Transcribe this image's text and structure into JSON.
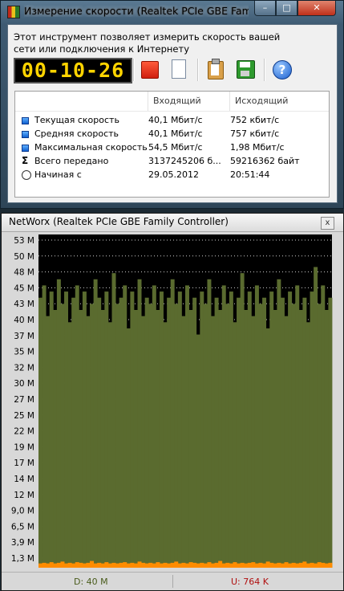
{
  "window1": {
    "title": "Измерение скорости (Realtek PCIe GBE Family Co...",
    "min_glyph": "–",
    "max_glyph": "□",
    "close_glyph": "✕",
    "description": "Этот инструмент позволяет измерить скорость вашей сети или подключения к Интернету",
    "timer": "00-10-26",
    "help_glyph": "?",
    "table": {
      "headers": [
        "",
        "Входящий",
        "Исходящий"
      ],
      "rows": [
        {
          "icon": "blue-square-icon",
          "label": "Текущая скорость",
          "in": "40,1 Мбит/с",
          "out": "752 кбит/с"
        },
        {
          "icon": "blue-square-icon",
          "label": "Средняя скорость",
          "in": "40,1 Мбит/с",
          "out": "757 кбит/с"
        },
        {
          "icon": "blue-square-icon",
          "label": "Максимальная скорость",
          "in": "54,5 Мбит/с",
          "out": "1,98 Мбит/с"
        },
        {
          "icon": "sigma-icon",
          "label": "Всего передано",
          "in": "3137245206 б...",
          "out": "59216362 байт"
        },
        {
          "icon": "clock-icon",
          "label": "Начиная с",
          "in": "29.05.2012",
          "out": "20:51:44"
        }
      ]
    }
  },
  "window2": {
    "title": "NetWorx (Realtek PCIe GBE Family Controller)",
    "close_glyph": "x",
    "status_download": "D: 40 M",
    "status_upload": "U: 764 K"
  },
  "colors": {
    "download_fill": "#5a6b2f",
    "upload_fill": "#ff8c00",
    "chart_bg": "#000000",
    "grid": "#d0d0d0"
  },
  "chart_data": {
    "type": "area",
    "title": "",
    "xlabel": "",
    "ylabel": "",
    "y_tick_labels": [
      "53 M",
      "50 M",
      "48 M",
      "45 M",
      "43 M",
      "40 M",
      "37 M",
      "35 M",
      "32 M",
      "30 M",
      "27 M",
      "25 M",
      "22 M",
      "19 M",
      "17 M",
      "14 M",
      "12 M",
      "9,0 M",
      "6,5 M",
      "3,9 M",
      "1,3 M"
    ],
    "ylim": [
      0,
      54.3
    ],
    "grid": true,
    "series": [
      {
        "color": "#5a6b2f",
        "values": [
          44,
          46,
          41,
          45,
          42,
          47,
          43,
          45,
          40,
          44,
          46,
          42,
          45,
          41,
          43,
          47,
          44,
          42,
          45,
          40,
          48,
          43,
          44,
          46,
          39,
          45,
          42,
          47,
          41,
          44,
          43,
          46,
          42,
          45,
          40,
          44,
          47,
          43,
          45,
          41,
          46,
          42,
          44,
          38,
          45,
          43,
          47,
          41,
          44,
          42,
          46,
          43,
          45,
          40,
          44,
          48,
          42,
          45,
          41,
          46,
          43,
          44,
          39,
          45,
          42,
          47,
          44,
          41,
          45,
          43,
          46,
          42,
          44,
          40,
          45,
          49,
          43,
          46,
          42,
          44
        ]
      },
      {
        "color": "#ff8c00",
        "values": [
          0.7,
          0.8,
          0.7,
          0.9,
          0.7,
          0.8,
          1.0,
          0.7,
          0.8,
          0.7,
          0.9,
          0.8,
          0.7,
          0.8,
          1.1,
          0.7,
          0.8,
          0.7,
          0.9,
          0.7,
          0.8,
          0.7,
          0.8,
          0.9,
          0.7,
          0.8,
          0.7,
          1.0,
          0.8,
          0.7,
          0.8,
          0.7,
          0.9,
          0.7,
          0.8,
          0.7,
          0.8,
          1.0,
          0.7,
          0.8,
          0.7,
          0.9,
          0.8,
          0.7,
          0.8,
          0.7,
          0.9,
          0.7,
          0.8,
          1.1,
          0.7,
          0.8,
          0.7,
          0.9,
          0.7,
          0.8,
          0.7,
          0.8,
          0.9,
          0.7,
          0.8,
          0.7,
          1.0,
          0.8,
          0.7,
          0.8,
          0.7,
          0.9,
          0.7,
          0.8,
          0.7,
          0.8,
          1.0,
          0.7,
          0.8,
          0.7,
          0.9,
          0.8,
          0.7,
          0.8
        ]
      }
    ]
  }
}
